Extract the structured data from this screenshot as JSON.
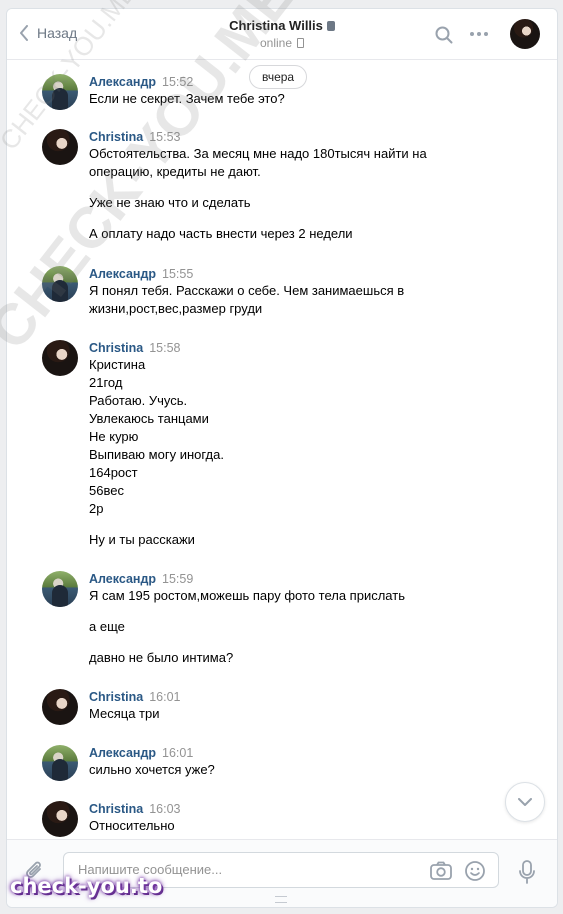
{
  "header": {
    "back_label": "Назад",
    "peer_name": "Christina Willis",
    "peer_status": "online"
  },
  "history": {
    "date_separator": "вчера",
    "messages": [
      {
        "author": "Александр",
        "time": "15:52",
        "avatar": "alex",
        "lines": [
          "Если не секрет. Зачем тебе это?"
        ]
      },
      {
        "author": "Christina",
        "time": "15:53",
        "avatar": "christina",
        "lines": [
          "Обстоятельства. За месяц мне надо 180тысяч найти на",
          "операцию, кредиты не дают.",
          "",
          "Уже не знаю что и сделать",
          "",
          "А оплату надо часть внести через 2 недели"
        ]
      },
      {
        "author": "Александр",
        "time": "15:55",
        "avatar": "alex",
        "lines": [
          "Я понял тебя. Расскажи о себе. Чем занимаешься в",
          "жизни,рост,вес,размер груди"
        ]
      },
      {
        "author": "Christina",
        "time": "15:58",
        "avatar": "christina",
        "lines": [
          "Кристина",
          "21год",
          "Работаю. Учусь.",
          "Увлекаюсь танцами",
          "Не курю",
          "Выпиваю могу иногда.",
          "164рост",
          "56вес",
          "2р",
          "",
          "Ну и ты расскажи"
        ]
      },
      {
        "author": "Александр",
        "time": "15:59",
        "avatar": "alex",
        "lines": [
          "Я сам 195 ростом,можешь пару фото тела прислать",
          "",
          "а еще",
          "",
          "давно не было интима?"
        ]
      },
      {
        "author": "Christina",
        "time": "16:01",
        "avatar": "christina",
        "lines": [
          "Месяца три"
        ]
      },
      {
        "author": "Александр",
        "time": "16:01",
        "avatar": "alex",
        "lines": [
          "сильно хочется уже?"
        ]
      },
      {
        "author": "Christina",
        "time": "16:03",
        "avatar": "christina",
        "lines": [
          "Относительно"
        ]
      }
    ]
  },
  "composer": {
    "placeholder": "Напишите сообщение..."
  },
  "watermarks": {
    "small": "CHECK-YOU.ME",
    "large": "CHECK-YOU.ME",
    "badge": "check-you.to"
  },
  "colors": {
    "author_link": "#2a5885",
    "time": "#939393",
    "background": "#edeef0"
  }
}
